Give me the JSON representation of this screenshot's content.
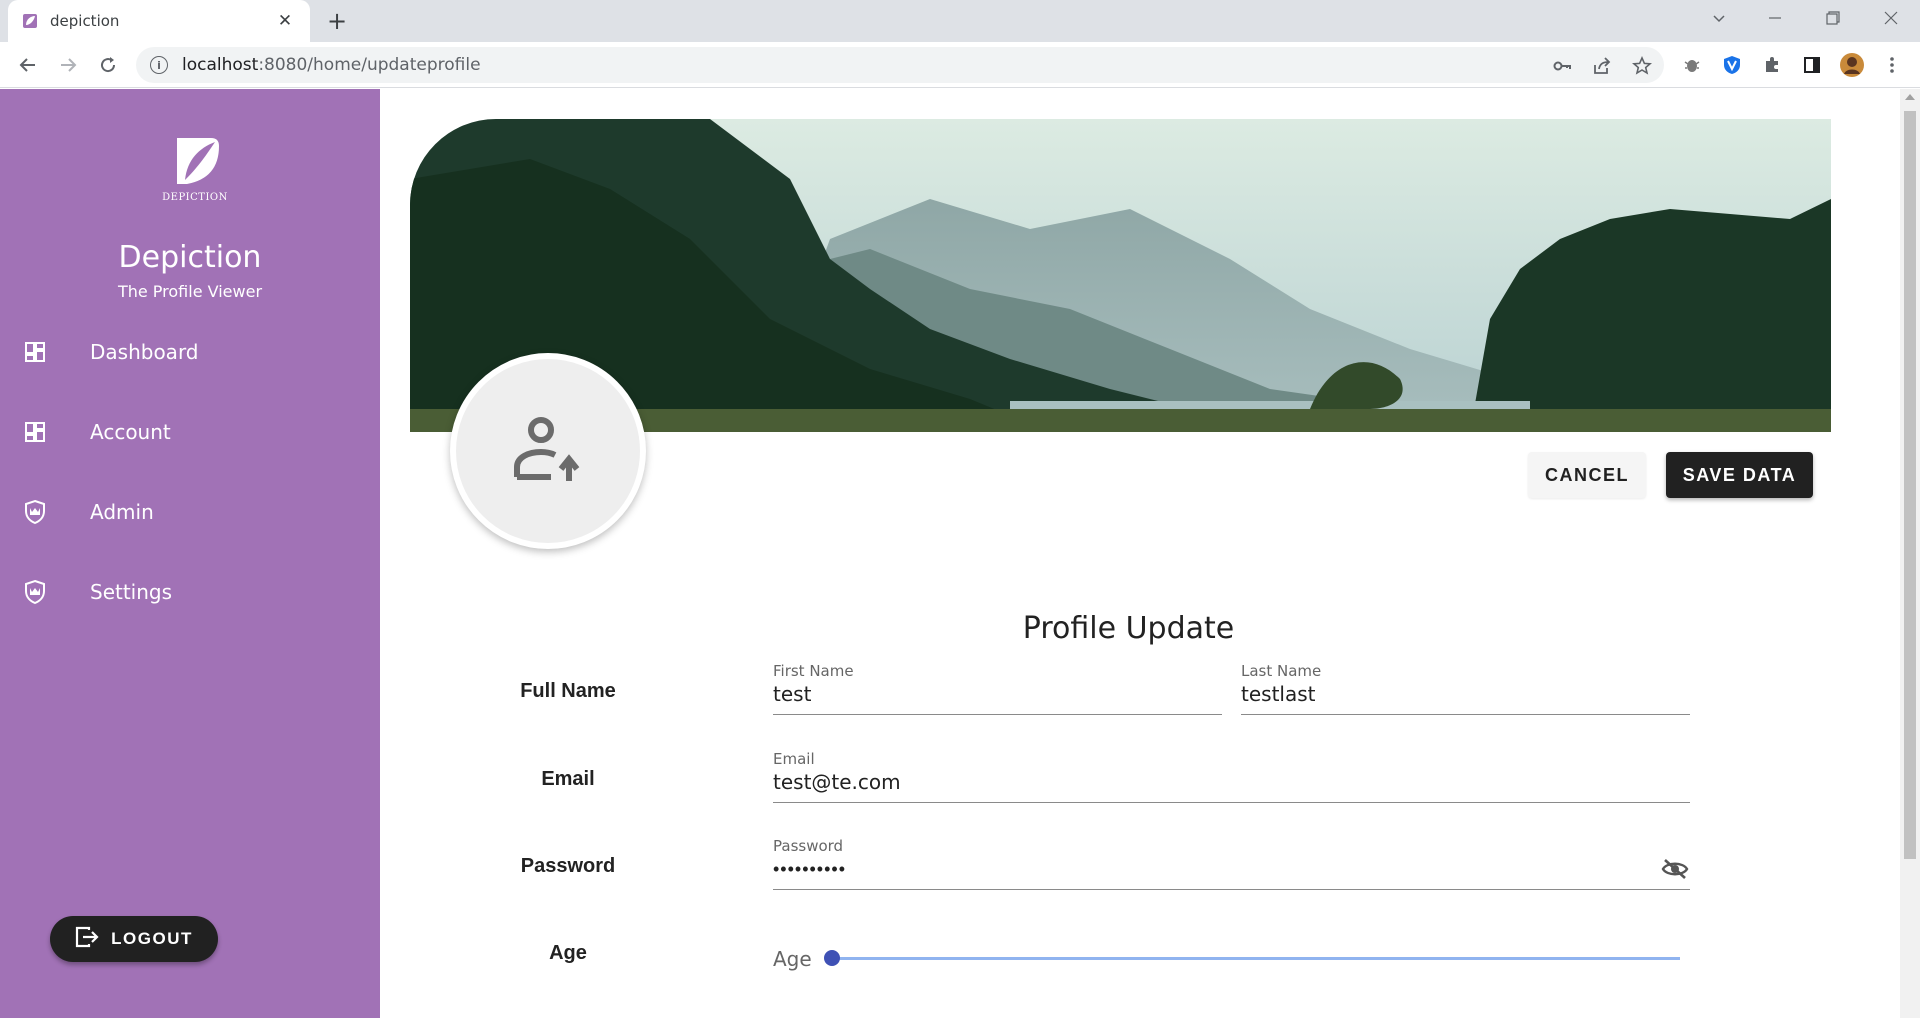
{
  "browser": {
    "tab_title": "depiction",
    "url_host": "localhost",
    "url_rest": ":8080/home/updateprofile"
  },
  "sidebar": {
    "brand_name": "Depiction",
    "brand_sub": "The Profile Viewer",
    "logo_text": "DEPICTION",
    "items": [
      {
        "label": "Dashboard",
        "icon": "dashboard-icon"
      },
      {
        "label": "Account",
        "icon": "dashboard-icon"
      },
      {
        "label": "Admin",
        "icon": "shield-crown-icon"
      },
      {
        "label": "Settings",
        "icon": "shield-crown-icon"
      }
    ],
    "logout_label": "LOGOUT"
  },
  "actions": {
    "cancel_label": "CANCEL",
    "save_label": "SAVE DATA"
  },
  "form": {
    "title": "Profile Update",
    "full_name_label": "Full Name",
    "first_name_label": "First Name",
    "first_name_value": "test",
    "last_name_label": "Last Name",
    "last_name_value": "testlast",
    "email_row_label": "Email",
    "email_label": "Email",
    "email_value": "test@te.com",
    "password_row_label": "Password",
    "password_label": "Password",
    "password_value": "••••••••••",
    "age_row_label": "Age",
    "age_label": "Age",
    "age_value": 0
  },
  "colors": {
    "sidebar_bg": "#a172b6",
    "button_dark": "#212121",
    "slider_thumb": "#3f51b5",
    "slider_track": "#90b4f0"
  }
}
